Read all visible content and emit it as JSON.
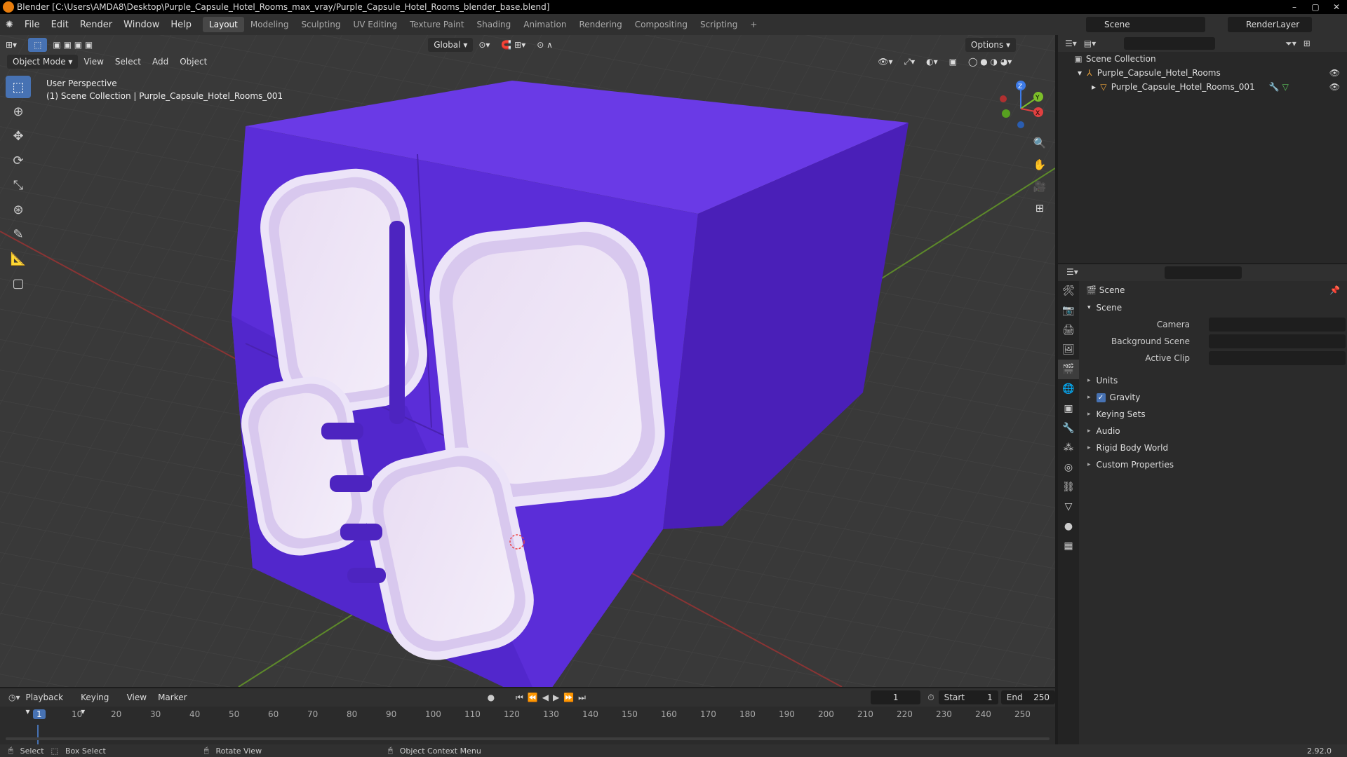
{
  "title": "Blender [C:\\Users\\AMDA8\\Desktop\\Purple_Capsule_Hotel_Rooms_max_vray/Purple_Capsule_Hotel_Rooms_blender_base.blend]",
  "menu": [
    "File",
    "Edit",
    "Render",
    "Window",
    "Help"
  ],
  "workspaces": [
    "Layout",
    "Modeling",
    "Sculpting",
    "UV Editing",
    "Texture Paint",
    "Shading",
    "Animation",
    "Rendering",
    "Compositing",
    "Scripting"
  ],
  "active_workspace": "Layout",
  "scene_name": "Scene",
  "render_layer": "RenderLayer",
  "viewport": {
    "mode": "Object Mode",
    "menus": [
      "View",
      "Select",
      "Add",
      "Object"
    ],
    "transform_orientation": "Global",
    "options": "Options",
    "overlay_title": "User Perspective",
    "overlay_sub": "(1) Scene Collection | Purple_Capsule_Hotel_Rooms_001",
    "gizmo": {
      "x": "X",
      "y": "Y",
      "z": "Z"
    },
    "colors": {
      "purple": "#5a2cd0",
      "purple_dark": "#4a22b0",
      "grid": "#3a3a3a"
    }
  },
  "outliner": {
    "root": "Scene Collection",
    "items": [
      "Purple_Capsule_Hotel_Rooms",
      "Purple_Capsule_Hotel_Rooms_001"
    ]
  },
  "properties": {
    "context": "Scene",
    "panel": "Scene",
    "fields": [
      {
        "label": "Camera"
      },
      {
        "label": "Background Scene"
      },
      {
        "label": "Active Clip"
      }
    ],
    "subpanels": [
      "Units",
      "Gravity",
      "Keying Sets",
      "Audio",
      "Rigid Body World",
      "Custom Properties"
    ],
    "gravity_checked": true
  },
  "timeline": {
    "menus": [
      "Playback",
      "Keying",
      "View",
      "Marker"
    ],
    "current_frame": "1",
    "start_label": "Start",
    "start": "1",
    "end_label": "End",
    "end": "250",
    "ticks": [
      "1",
      "10",
      "20",
      "30",
      "40",
      "50",
      "60",
      "70",
      "80",
      "90",
      "100",
      "110",
      "120",
      "130",
      "140",
      "150",
      "160",
      "170",
      "180",
      "190",
      "200",
      "210",
      "220",
      "230",
      "240",
      "250"
    ]
  },
  "status": {
    "select": "Select",
    "box_select": "Box Select",
    "rotate_view": "Rotate View",
    "context_menu": "Object Context Menu",
    "version": "2.92.0"
  }
}
